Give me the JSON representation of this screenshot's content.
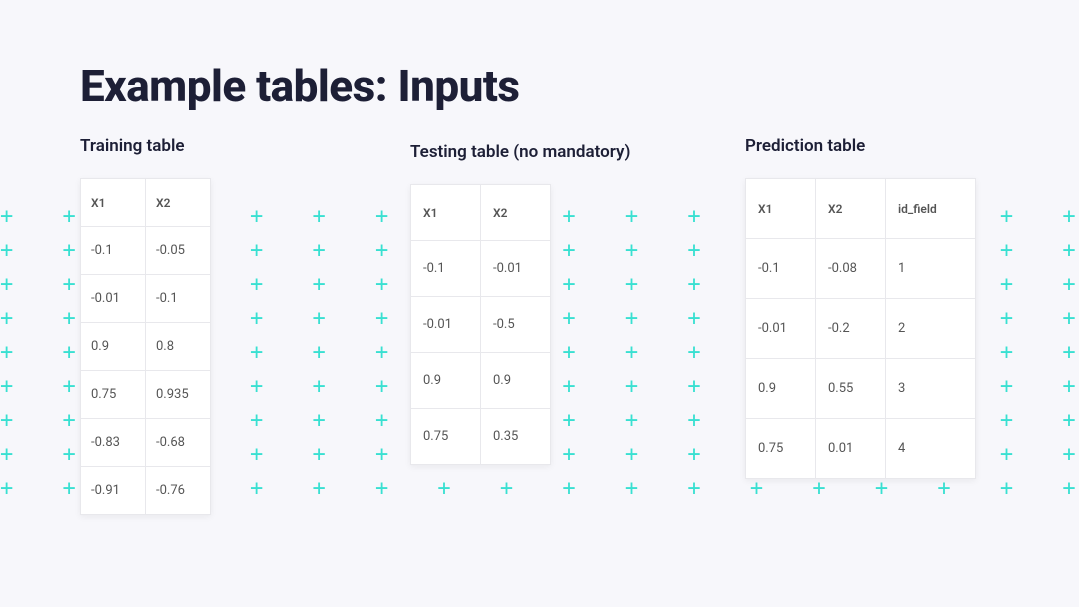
{
  "title": "Example tables: Inputs",
  "training": {
    "label": "Training table",
    "headers": [
      "X1",
      "X2"
    ],
    "rows": [
      [
        "-0.1",
        "-0.05"
      ],
      [
        "-0.01",
        "-0.1"
      ],
      [
        "0.9",
        "0.8"
      ],
      [
        "0.75",
        "0.935"
      ],
      [
        "-0.83",
        "-0.68"
      ],
      [
        "-0.91",
        "-0.76"
      ]
    ]
  },
  "testing": {
    "label": "Testing table (no mandatory)",
    "headers": [
      "X1",
      "X2"
    ],
    "rows": [
      [
        "-0.1",
        "-0.01"
      ],
      [
        "-0.01",
        "-0.5"
      ],
      [
        "0.9",
        "0.9"
      ],
      [
        "0.75",
        "0.35"
      ]
    ]
  },
  "prediction": {
    "label": "Prediction table",
    "headers": [
      "X1",
      "X2",
      "id_field"
    ],
    "rows": [
      [
        "-0.1",
        "-0.08",
        "1"
      ],
      [
        "-0.01",
        "-0.2",
        "2"
      ],
      [
        "0.9",
        "0.55",
        "3"
      ],
      [
        "0.75",
        "0.01",
        "4"
      ]
    ]
  },
  "chart_data": [
    {
      "type": "table",
      "title": "Training table",
      "headers": [
        "X1",
        "X2"
      ],
      "rows": [
        [
          -0.1,
          -0.05
        ],
        [
          -0.01,
          -0.1
        ],
        [
          0.9,
          0.8
        ],
        [
          0.75,
          0.935
        ],
        [
          -0.83,
          -0.68
        ],
        [
          -0.91,
          -0.76
        ]
      ]
    },
    {
      "type": "table",
      "title": "Testing table (no mandatory)",
      "headers": [
        "X1",
        "X2"
      ],
      "rows": [
        [
          -0.1,
          -0.01
        ],
        [
          -0.01,
          -0.5
        ],
        [
          0.9,
          0.9
        ],
        [
          0.75,
          0.35
        ]
      ]
    },
    {
      "type": "table",
      "title": "Prediction table",
      "headers": [
        "X1",
        "X2",
        "id_field"
      ],
      "rows": [
        [
          -0.1,
          -0.08,
          1
        ],
        [
          -0.01,
          -0.2,
          2
        ],
        [
          0.9,
          0.55,
          3
        ],
        [
          0.75,
          0.01,
          4
        ]
      ]
    }
  ]
}
